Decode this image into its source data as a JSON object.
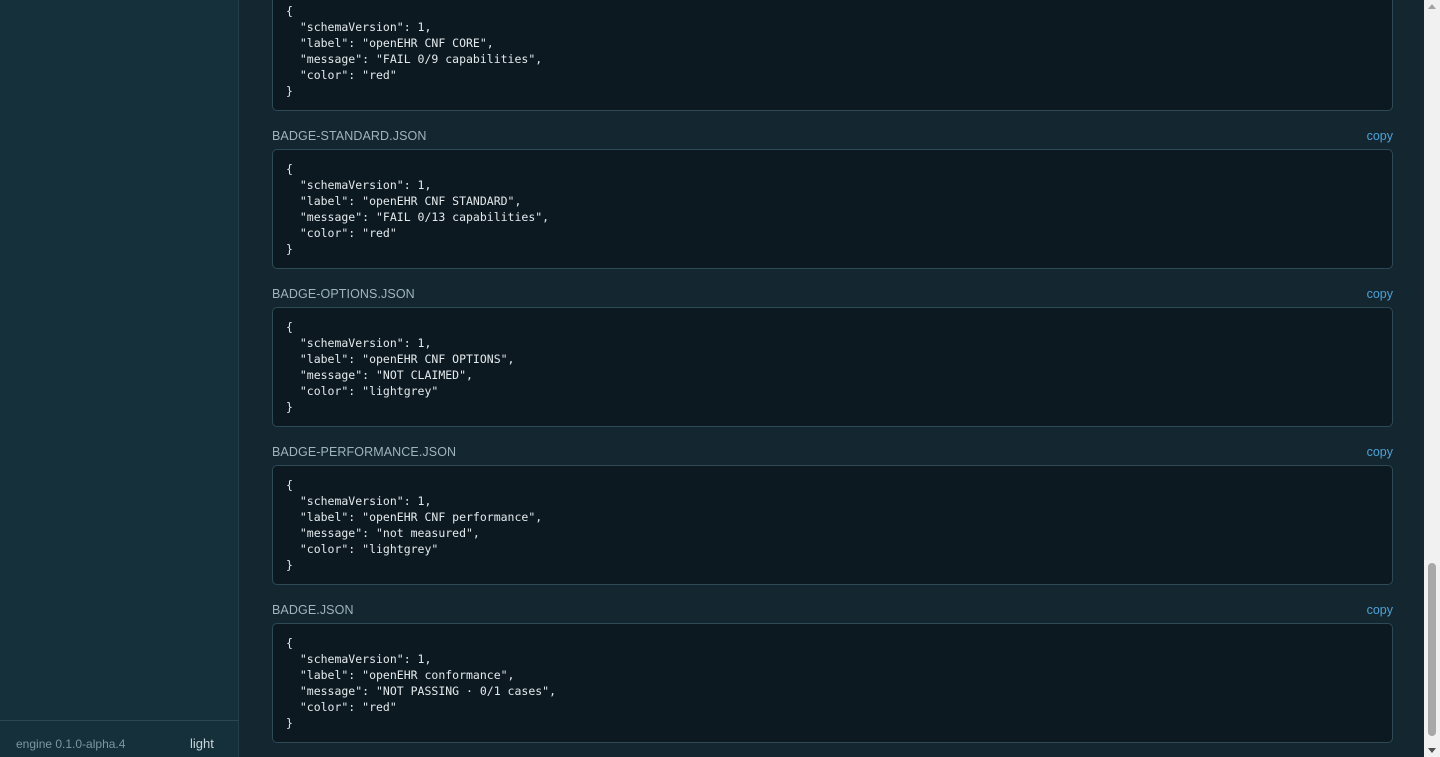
{
  "sidebar": {
    "engine_version": "engine 0.1.0-alpha.4",
    "theme_toggle": "light"
  },
  "main": {
    "copy_label": "copy",
    "blocks": [
      {
        "filename": "",
        "code": "{\n  \"schemaVersion\": 1,\n  \"label\": \"openEHR CNF CORE\",\n  \"message\": \"FAIL 0/9 capabilities\",\n  \"color\": \"red\"\n}"
      },
      {
        "filename": "BADGE-STANDARD.JSON",
        "code": "{\n  \"schemaVersion\": 1,\n  \"label\": \"openEHR CNF STANDARD\",\n  \"message\": \"FAIL 0/13 capabilities\",\n  \"color\": \"red\"\n}"
      },
      {
        "filename": "BADGE-OPTIONS.JSON",
        "code": "{\n  \"schemaVersion\": 1,\n  \"label\": \"openEHR CNF OPTIONS\",\n  \"message\": \"NOT CLAIMED\",\n  \"color\": \"lightgrey\"\n}"
      },
      {
        "filename": "BADGE-PERFORMANCE.JSON",
        "code": "{\n  \"schemaVersion\": 1,\n  \"label\": \"openEHR CNF performance\",\n  \"message\": \"not measured\",\n  \"color\": \"lightgrey\"\n}"
      },
      {
        "filename": "BADGE.JSON",
        "code": "{\n  \"schemaVersion\": 1,\n  \"label\": \"openEHR conformance\",\n  \"message\": \"NOT PASSING · 0/1 cases\",\n  \"color\": \"red\"\n}"
      }
    ]
  },
  "colors": {
    "page_background": "#142630",
    "sidebar_background": "#16303b",
    "code_background": "#0c1920",
    "code_text": "#e3e9ec",
    "link": "#4aa3d6",
    "file_label": "#9fb4bd"
  }
}
